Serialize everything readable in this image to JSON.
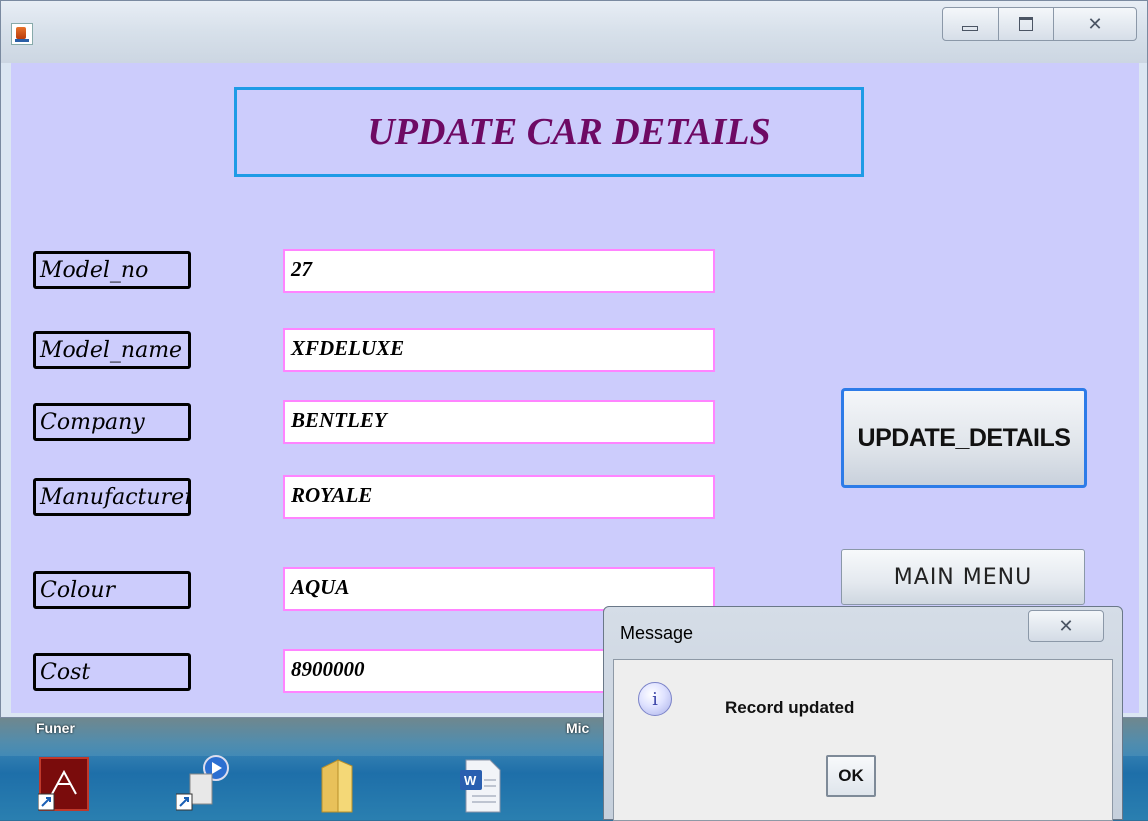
{
  "window": {
    "controls": {
      "minimize": "",
      "maximize": "",
      "close": "✕"
    }
  },
  "form": {
    "title": "UPDATE CAR DETAILS",
    "fields": [
      {
        "label": "Model_no",
        "value": "27"
      },
      {
        "label": "Model_name",
        "value": "XFDELUXE"
      },
      {
        "label": "Company",
        "value": "BENTLEY"
      },
      {
        "label": "Manufacturer",
        "value": "ROYALE"
      },
      {
        "label": "Colour",
        "value": "AQUA"
      },
      {
        "label": "Cost",
        "value": "8900000"
      }
    ],
    "update_button": "UPDATE_DETAILS",
    "menu_button": "MAIN MENU"
  },
  "dialog": {
    "title": "Message",
    "close": "✕",
    "icon": "info-icon",
    "message": "Record updated",
    "ok": "OK"
  },
  "desktop": {
    "captions": [
      "Funer",
      "Mic"
    ]
  },
  "colors": {
    "form_bg": "#ccccfc",
    "title_text": "#6e0a64",
    "title_border": "#1e9be6",
    "field_border": "#ff84ff",
    "update_border": "#2d7be8"
  }
}
